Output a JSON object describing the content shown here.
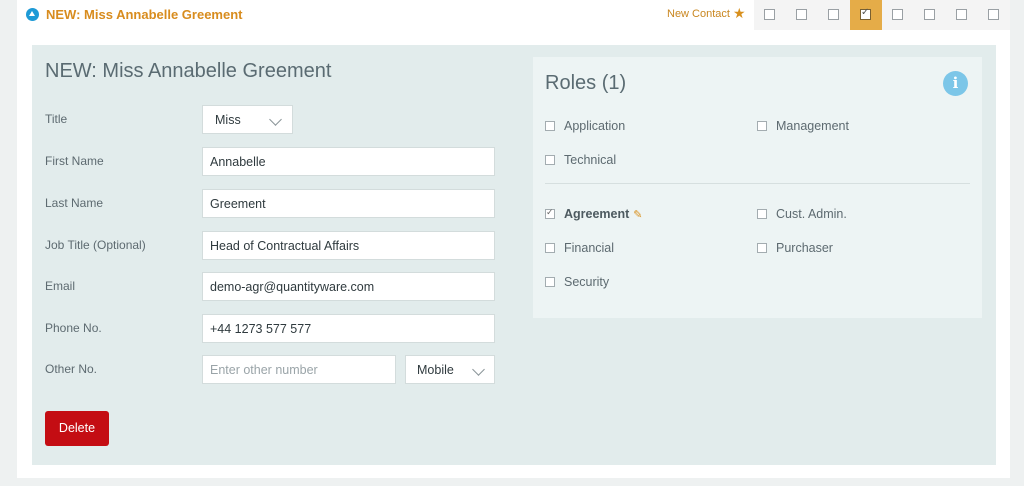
{
  "header": {
    "title": "NEW: Miss Annabelle Greement",
    "new_contact_label": "New Contact",
    "checkbox_strip": [
      false,
      false,
      false,
      true,
      false,
      false,
      false,
      false
    ]
  },
  "form": {
    "title": "NEW: Miss Annabelle Greement",
    "title_label": "Title",
    "title_value": "Miss",
    "first_name_label": "First Name",
    "first_name_value": "Annabelle",
    "last_name_label": "Last Name",
    "last_name_value": "Greement",
    "job_title_label": "Job Title (Optional)",
    "job_title_value": "Head of Contractual Affairs",
    "email_label": "Email",
    "email_value": "demo-agr@quantityware.com",
    "phone_label": "Phone No.",
    "phone_value": "+44 1273 577 577",
    "other_label": "Other No.",
    "other_placeholder": "Enter other number",
    "other_type_value": "Mobile",
    "delete_label": "Delete"
  },
  "roles": {
    "title": "Roles (1)",
    "info_glyph": "i",
    "group1": [
      {
        "label": "Application",
        "checked": false
      },
      {
        "label": "Management",
        "checked": false
      },
      {
        "label": "Technical",
        "checked": false
      }
    ],
    "group2": [
      {
        "label": "Agreement",
        "checked": true
      },
      {
        "label": "Cust. Admin.",
        "checked": false
      },
      {
        "label": "Financial",
        "checked": false
      },
      {
        "label": "Purchaser",
        "checked": false
      },
      {
        "label": "Security",
        "checked": false
      }
    ]
  },
  "colors": {
    "accent": "#d88c1e",
    "active_strip": "#e5ac48",
    "delete": "#c40d13",
    "info": "#7cc6e8"
  }
}
